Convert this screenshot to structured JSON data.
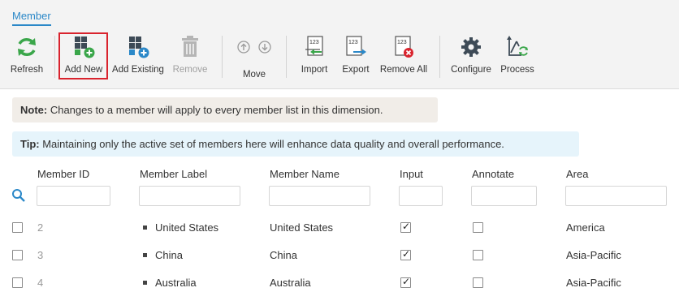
{
  "tab": {
    "label": "Member"
  },
  "toolbar": {
    "refresh": "Refresh",
    "add_new": "Add New",
    "add_existing": "Add Existing",
    "remove": "Remove",
    "move": "Move",
    "import": "Import",
    "export": "Export",
    "remove_all": "Remove All",
    "configure": "Configure",
    "process": "Process",
    "icon_text_123": "123"
  },
  "note": {
    "prefix": "Note:",
    "text": " Changes to a member will apply to every member list in this dimension."
  },
  "tip": {
    "prefix": "Tip:",
    "text": " Maintaining only the active set of members here will enhance data quality and overall performance."
  },
  "columns": [
    "Member ID",
    "Member Label",
    "Member Name",
    "Input",
    "Annotate",
    "Area"
  ],
  "rows": [
    {
      "id": "2",
      "label": "United States",
      "name": "United States",
      "input": true,
      "annotate": false,
      "area": "America"
    },
    {
      "id": "3",
      "label": "China",
      "name": "China",
      "input": true,
      "annotate": false,
      "area": "Asia-Pacific"
    },
    {
      "id": "4",
      "label": "Australia",
      "name": "Australia",
      "input": true,
      "annotate": false,
      "area": "Asia-Pacific"
    }
  ],
  "colors": {
    "accent": "#2b88c8",
    "highlight": "#d9232d",
    "green": "#3aa64a"
  }
}
